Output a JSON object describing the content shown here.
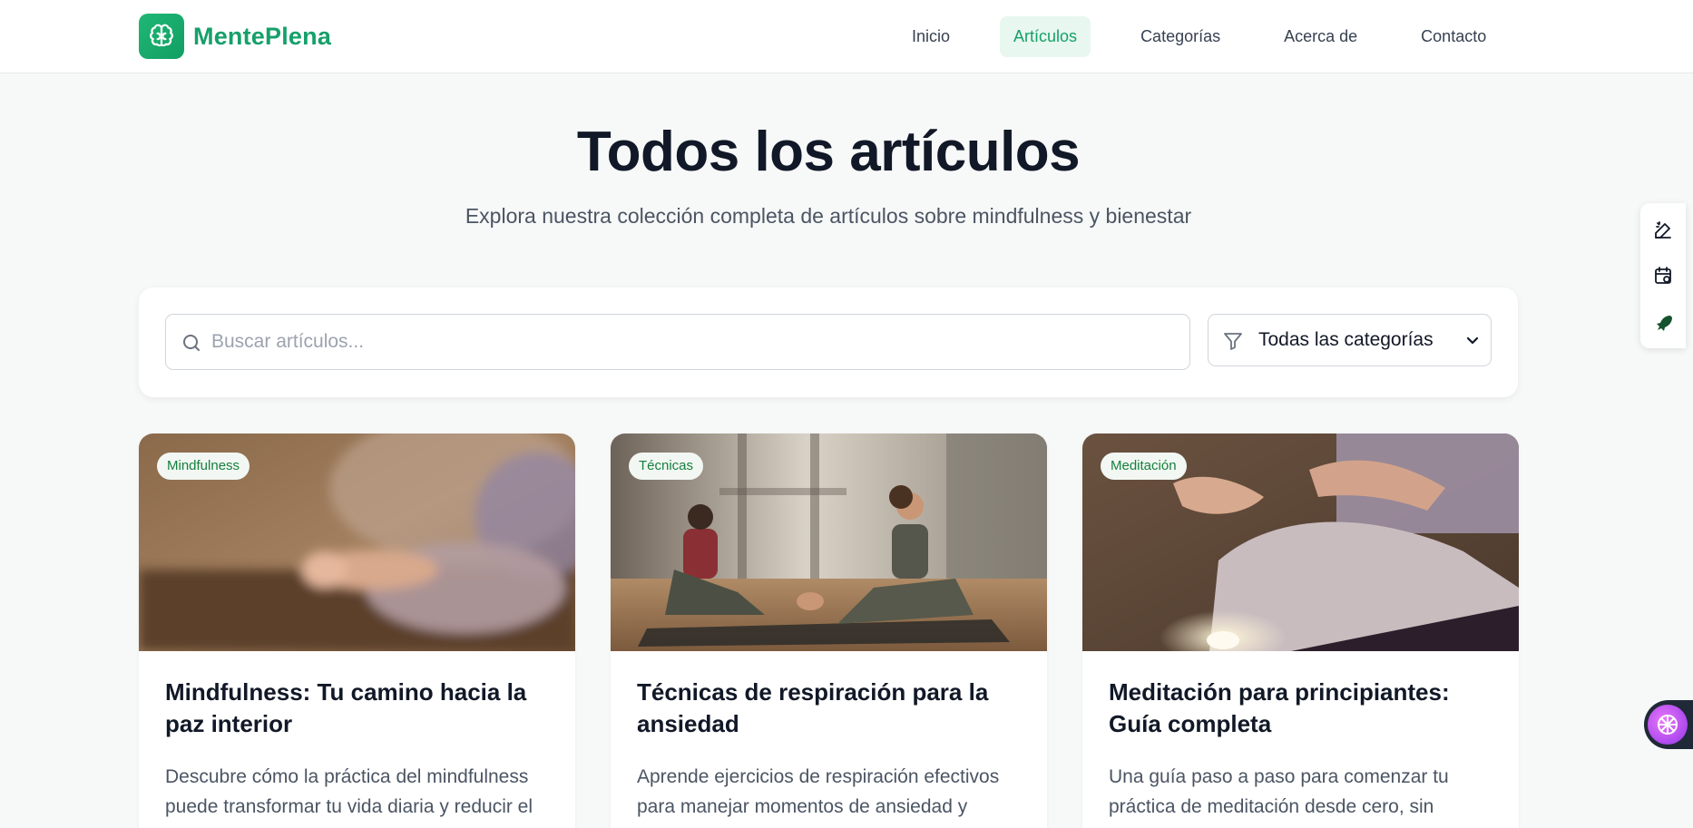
{
  "brand": {
    "name": "MentePlena"
  },
  "nav": {
    "items": [
      {
        "label": "Inicio",
        "active": false
      },
      {
        "label": "Artículos",
        "active": true
      },
      {
        "label": "Categorías",
        "active": false
      },
      {
        "label": "Acerca de",
        "active": false
      },
      {
        "label": "Contacto",
        "active": false
      }
    ]
  },
  "hero": {
    "title": "Todos los artículos",
    "subtitle": "Explora nuestra colección completa de artículos sobre mindfulness y bienestar"
  },
  "filters": {
    "search_placeholder": "Buscar artículos...",
    "search_value": "",
    "category_selected": "Todas las categorías"
  },
  "articles": [
    {
      "tag": "Mindfulness",
      "title": "Mindfulness: Tu camino hacia la paz interior",
      "description": "Descubre cómo la práctica del mindfulness puede transformar tu vida diaria y reducir el estrés."
    },
    {
      "tag": "Técnicas",
      "title": "Técnicas de respiración para la ansiedad",
      "description": "Aprende ejercicios de respiración efectivos para manejar momentos de ansiedad y estrés."
    },
    {
      "tag": "Meditación",
      "title": "Meditación para principiantes: Guía completa",
      "description": "Una guía paso a paso para comenzar tu práctica de meditación desde cero, sin experiencia previa."
    }
  ],
  "side_tools": [
    "edit-pen-icon",
    "calendar-icon",
    "rocket-icon"
  ],
  "colors": {
    "brand": "#16a06a",
    "active_nav_bg": "#e8f7ef",
    "tag_text": "#15803d"
  }
}
